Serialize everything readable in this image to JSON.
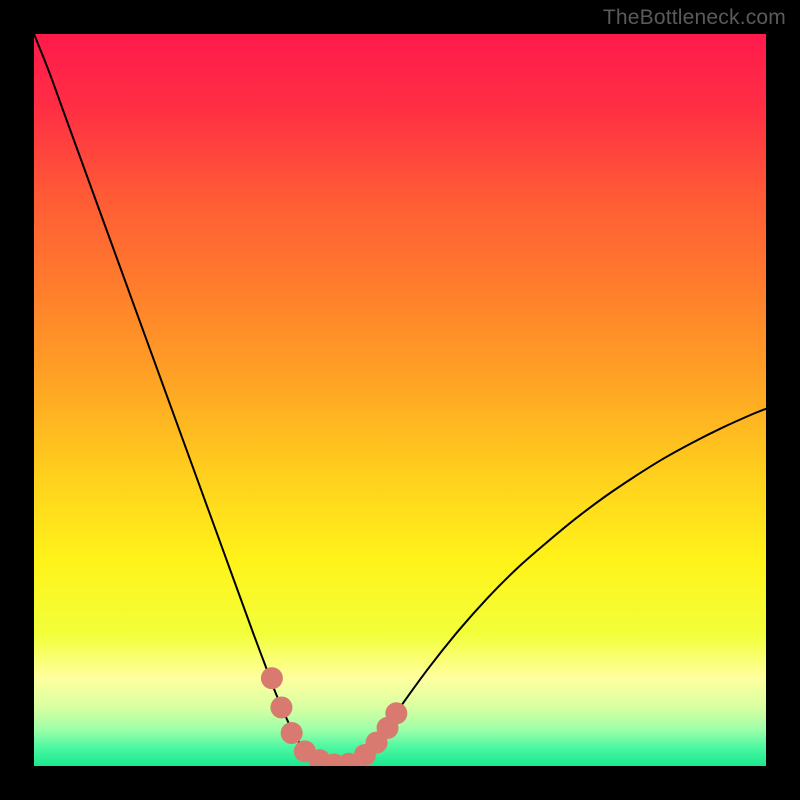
{
  "watermark": "TheBottleneck.com",
  "chart_data": {
    "type": "line",
    "title": "",
    "xlabel": "",
    "ylabel": "",
    "xlim": [
      0,
      100
    ],
    "ylim": [
      0,
      100
    ],
    "grid": false,
    "legend": false,
    "background": {
      "type": "vertical-gradient",
      "stops": [
        {
          "offset": 0.0,
          "color": "#ff1a4b"
        },
        {
          "offset": 0.1,
          "color": "#ff2e44"
        },
        {
          "offset": 0.22,
          "color": "#ff5a36"
        },
        {
          "offset": 0.35,
          "color": "#ff7e2c"
        },
        {
          "offset": 0.48,
          "color": "#ffa524"
        },
        {
          "offset": 0.6,
          "color": "#ffcf1d"
        },
        {
          "offset": 0.72,
          "color": "#fff31a"
        },
        {
          "offset": 0.82,
          "color": "#f2ff3a"
        },
        {
          "offset": 0.88,
          "color": "#ffff9f"
        },
        {
          "offset": 0.92,
          "color": "#d8ffa2"
        },
        {
          "offset": 0.95,
          "color": "#9effa8"
        },
        {
          "offset": 0.975,
          "color": "#4cf7a2"
        },
        {
          "offset": 1.0,
          "color": "#19e88f"
        }
      ]
    },
    "series": [
      {
        "name": "bottleneck-curve",
        "color": "#000000",
        "width": 2,
        "x": [
          0,
          2,
          4,
          6,
          8,
          10,
          12,
          14,
          16,
          18,
          20,
          22,
          24,
          26,
          28,
          30,
          31.5,
          33,
          34.5,
          36,
          38,
          40,
          41,
          42,
          44,
          46,
          48,
          50,
          54,
          58,
          62,
          66,
          70,
          74,
          78,
          82,
          86,
          90,
          94,
          98,
          100
        ],
        "y": [
          100,
          95,
          89.5,
          84,
          78.5,
          73,
          67.5,
          62,
          56.5,
          51,
          45.5,
          40,
          34.5,
          29,
          23.5,
          18,
          14,
          10,
          6.5,
          3.5,
          1.5,
          0.4,
          0.1,
          0.1,
          0.8,
          2.5,
          5,
          8,
          13.5,
          18.5,
          23,
          27,
          30.5,
          33.8,
          36.8,
          39.5,
          42,
          44.2,
          46.2,
          48,
          48.8
        ]
      }
    ],
    "markers": {
      "name": "highlight-dots",
      "color": "#d97a70",
      "radius_px": 11,
      "points": [
        {
          "x": 32.5,
          "y": 12
        },
        {
          "x": 33.8,
          "y": 8
        },
        {
          "x": 35.2,
          "y": 4.5
        },
        {
          "x": 37.0,
          "y": 2
        },
        {
          "x": 39.0,
          "y": 0.8
        },
        {
          "x": 41.0,
          "y": 0.2
        },
        {
          "x": 43.0,
          "y": 0.3
        },
        {
          "x": 45.2,
          "y": 1.5
        },
        {
          "x": 46.8,
          "y": 3.2
        },
        {
          "x": 48.3,
          "y": 5.2
        },
        {
          "x": 49.5,
          "y": 7.2
        }
      ]
    }
  }
}
